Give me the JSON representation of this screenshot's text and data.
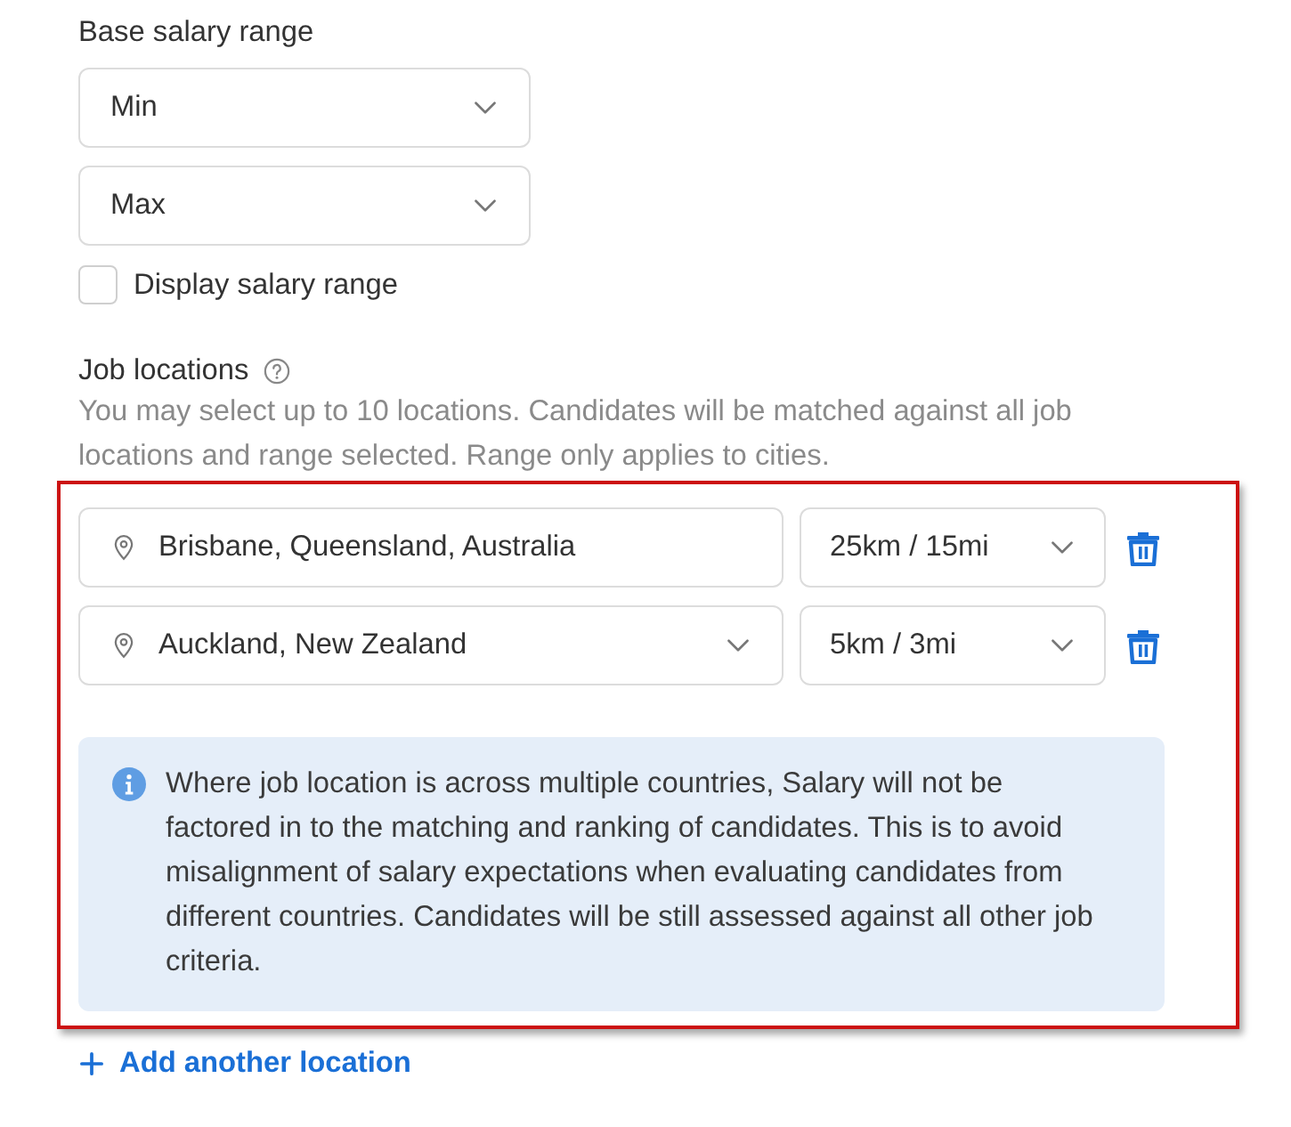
{
  "salary": {
    "label": "Base salary range",
    "selects": [
      {
        "value": "Min"
      },
      {
        "value": "Max"
      }
    ],
    "display_checkbox": {
      "label": "Display salary range",
      "checked": false
    }
  },
  "job_locations": {
    "label": "Job locations",
    "help": "You may select up to 10 locations. Candidates will be matched against all job locations and range selected. Range only applies to cities.",
    "locations": [
      {
        "kind": "input",
        "place": "Brisbane, Queensland, Australia",
        "range": "25km / 15mi"
      },
      {
        "kind": "select",
        "place": "Auckland, New Zealand",
        "range": "5km / 3mi"
      }
    ],
    "info": "Where job location is across multiple countries, Salary will not be factored in to the matching and ranking of candidates. This is to avoid misalignment of salary expectations when evaluating candidates from different countries. Candidates will be still assessed against all other job criteria.",
    "add_link": "Add another location"
  }
}
